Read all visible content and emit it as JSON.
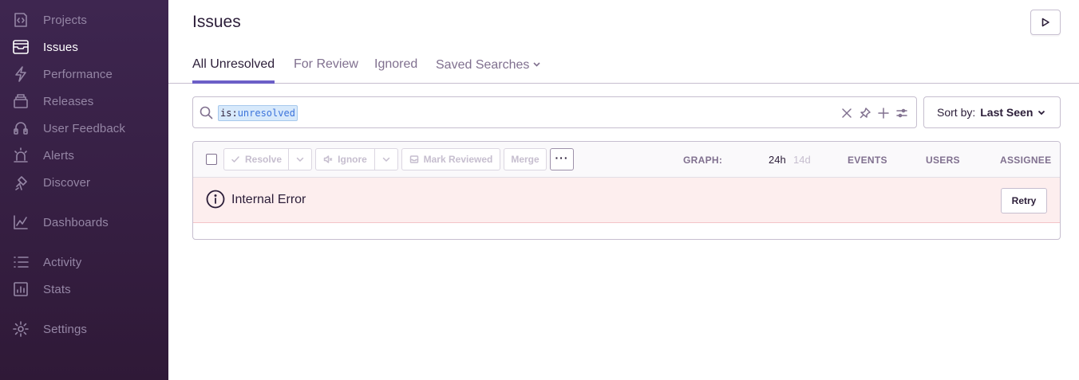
{
  "sidebar": {
    "items": [
      {
        "label": "Projects",
        "icon": "projects-icon",
        "active": false
      },
      {
        "label": "Issues",
        "icon": "issues-icon",
        "active": true
      },
      {
        "label": "Performance",
        "icon": "performance-icon",
        "active": false
      },
      {
        "label": "Releases",
        "icon": "releases-icon",
        "active": false
      },
      {
        "label": "User Feedback",
        "icon": "user-feedback-icon",
        "active": false
      },
      {
        "label": "Alerts",
        "icon": "alerts-icon",
        "active": false
      },
      {
        "label": "Discover",
        "icon": "discover-icon",
        "active": false
      },
      {
        "label": "Dashboards",
        "icon": "dashboards-icon",
        "active": false
      },
      {
        "label": "Activity",
        "icon": "activity-icon",
        "active": false
      },
      {
        "label": "Stats",
        "icon": "stats-icon",
        "active": false
      },
      {
        "label": "Settings",
        "icon": "settings-icon",
        "active": false
      }
    ]
  },
  "header": {
    "title": "Issues",
    "tabs": [
      "All Unresolved",
      "For Review",
      "Ignored",
      "Saved Searches"
    ],
    "active_tab": "All Unresolved"
  },
  "search": {
    "token_key": "is:",
    "token_value": "unresolved"
  },
  "sort": {
    "prefix": "Sort by:",
    "value": "Last Seen"
  },
  "toolbar": {
    "resolve": "Resolve",
    "ignore": "Ignore",
    "mark_reviewed": "Mark Reviewed",
    "merge": "Merge",
    "more": "···"
  },
  "columns": {
    "graph": "GRAPH:",
    "range_24h": "24h",
    "range_14d": "14d",
    "events": "EVENTS",
    "users": "USERS",
    "assignee": "ASSIGNEE"
  },
  "error": {
    "message": "Internal Error",
    "retry": "Retry"
  },
  "colors": {
    "sidebar_bg": "#3e2650",
    "accent": "#6c5fc7",
    "error_bg": "#fdeeee"
  }
}
